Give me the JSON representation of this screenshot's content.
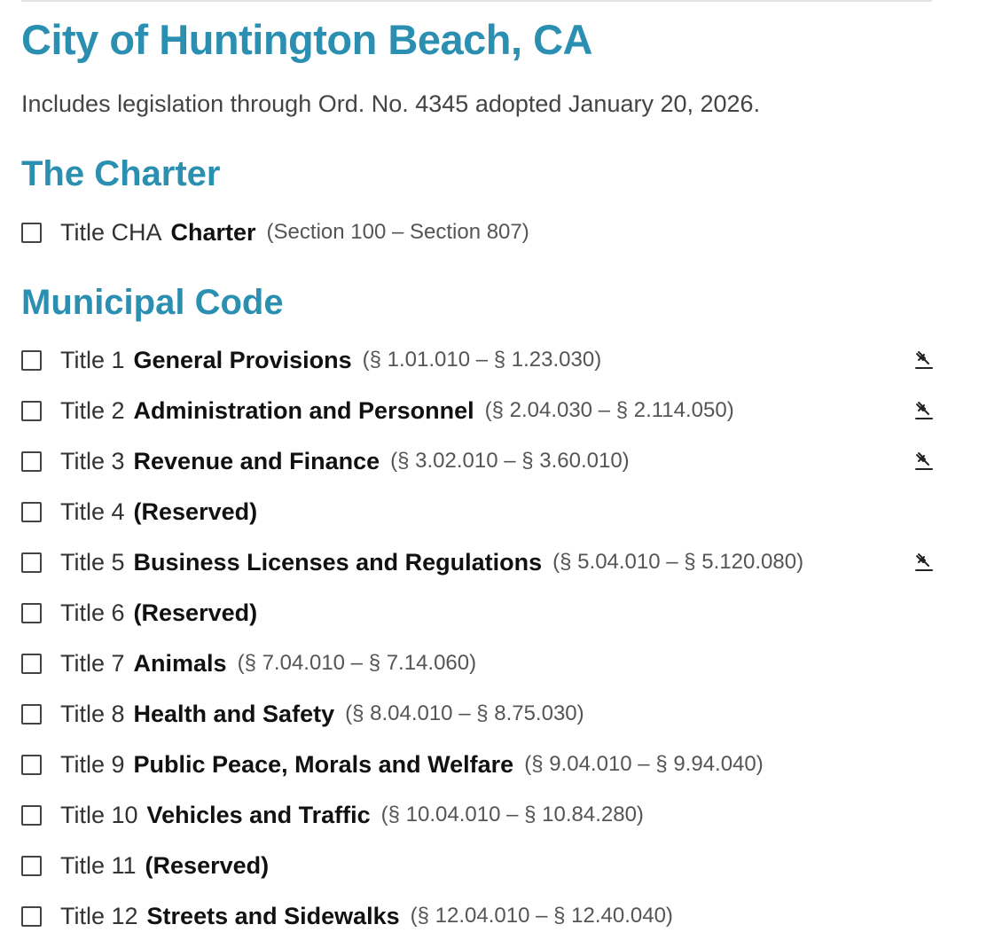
{
  "header": {
    "city_title": "City of Huntington Beach, CA",
    "legislation_note": "Includes legislation through Ord. No. 4345 adopted January 20, 2026."
  },
  "charter": {
    "heading": "The Charter",
    "items": [
      {
        "number": "Title CHA",
        "name": "Charter",
        "range": "(Section 100 – Section 807)",
        "checked": false,
        "has_amendment_icon": false
      }
    ]
  },
  "municipal_code": {
    "heading": "Municipal Code",
    "items": [
      {
        "number": "Title 1",
        "name": "General Provisions",
        "range": "(§ 1.01.010 – § 1.23.030)",
        "checked": false,
        "has_amendment_icon": true
      },
      {
        "number": "Title 2",
        "name": "Administration and Personnel",
        "range": "(§ 2.04.030 – § 2.114.050)",
        "checked": false,
        "has_amendment_icon": true
      },
      {
        "number": "Title 3",
        "name": "Revenue and Finance",
        "range": "(§ 3.02.010 – § 3.60.010)",
        "checked": false,
        "has_amendment_icon": true
      },
      {
        "number": "Title 4",
        "name": "(Reserved)",
        "range": "",
        "checked": false,
        "has_amendment_icon": false
      },
      {
        "number": "Title 5",
        "name": "Business Licenses and Regulations",
        "range": "(§ 5.04.010 – § 5.120.080)",
        "checked": false,
        "has_amendment_icon": true
      },
      {
        "number": "Title 6",
        "name": "(Reserved)",
        "range": "",
        "checked": false,
        "has_amendment_icon": false
      },
      {
        "number": "Title 7",
        "name": "Animals",
        "range": "(§ 7.04.010 – § 7.14.060)",
        "checked": false,
        "has_amendment_icon": false
      },
      {
        "number": "Title 8",
        "name": "Health and Safety",
        "range": "(§ 8.04.010 – § 8.75.030)",
        "checked": false,
        "has_amendment_icon": false
      },
      {
        "number": "Title 9",
        "name": "Public Peace, Morals and Welfare",
        "range": "(§ 9.04.010 – § 9.94.040)",
        "checked": false,
        "has_amendment_icon": false
      },
      {
        "number": "Title 10",
        "name": "Vehicles and Traffic",
        "range": "(§ 10.04.010 – § 10.84.280)",
        "checked": false,
        "has_amendment_icon": false
      },
      {
        "number": "Title 11",
        "name": "(Reserved)",
        "range": "",
        "checked": false,
        "has_amendment_icon": false
      },
      {
        "number": "Title 12",
        "name": "Streets and Sidewalks",
        "range": "(§ 12.04.010 – § 12.40.040)",
        "checked": false,
        "has_amendment_icon": false
      }
    ]
  },
  "icons": {
    "amendment": "gavel-icon",
    "checkbox": "checkbox-unchecked-icon"
  },
  "colors": {
    "heading": "#2a8fb0",
    "text": "#111111"
  }
}
